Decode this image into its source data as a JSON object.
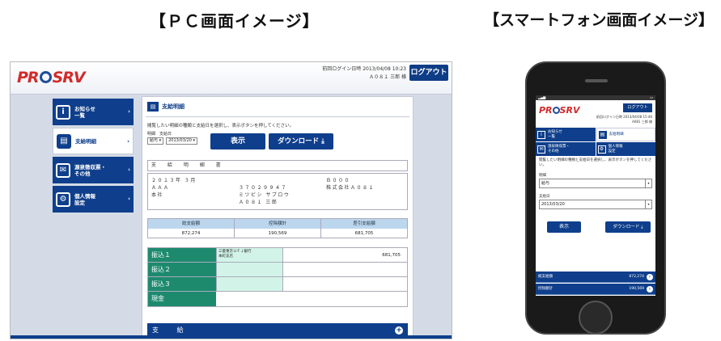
{
  "captions": {
    "pc": "【ＰＣ画面イメージ】",
    "sp": "【スマートフォン画面イメージ】"
  },
  "pc": {
    "logo": {
      "pre": "PR",
      "post": "SRV"
    },
    "login_label": "前回ログイン日時 2013/04/08 10:23",
    "user_name": "Ａ０８１ 三郎 様",
    "logout_label": "ログアウト",
    "menu": [
      {
        "label": "お知らせ\n一覧",
        "icon": "info-icon"
      },
      {
        "label": "支給明細",
        "icon": "statement-icon"
      },
      {
        "label": "源泉徴収票・\nその他",
        "icon": "withholding-icon"
      },
      {
        "label": "個人情報\n設定",
        "icon": "settings-icon"
      }
    ],
    "section_title": "支給明細",
    "instruction": "閲覧したい明細の種類と支給日を選択し、表示ボタンを押してください。",
    "select_labels": "明細　支給日",
    "select_kind": "給与",
    "select_date": "2013/03/20",
    "show_button": "表示",
    "download_button": "ダウンロード",
    "slip_heading": "支 給 明 細 書",
    "slip": {
      "period": "２０１３年 ３月",
      "dept_code": "ＡＡＡ",
      "dept": "本社",
      "emp_code": "３７０２９９４７",
      "kana": "ミツビシ サブロウ",
      "name": "Ａ０８１ 三郎",
      "company_code": "Ｂ０００",
      "company": "株式会社Ａ０８１"
    },
    "totals": {
      "headers": [
        "総支給額",
        "控除額計",
        "差引支給額"
      ],
      "values": [
        "872,274",
        "190,569",
        "681,705"
      ]
    },
    "bank_rows": [
      {
        "label": "振込１",
        "bank": "三菱東京ＵＦＪ銀行\n本町支店",
        "amount": "681,705"
      },
      {
        "label": "振込２",
        "bank": "",
        "amount": ""
      },
      {
        "label": "振込３",
        "bank": "",
        "amount": ""
      },
      {
        "label": "現金",
        "bank": "",
        "amount": ""
      }
    ],
    "shikyu_label": "支 給"
  },
  "sp": {
    "logo": {
      "pre": "PR",
      "post": "SRV"
    },
    "logout_label": "ログアウト",
    "login_label": "前回ログイン日時 2013/04/08 15:46",
    "user_name": "A081 三郎 様",
    "menu": [
      {
        "label": "お知らせ\n一覧",
        "icon": "info-icon"
      },
      {
        "label": "支給明細",
        "icon": "statement-icon"
      },
      {
        "label": "源泉徴収票・\nその他",
        "icon": "withholding-icon"
      },
      {
        "label": "個人情報\n設定",
        "icon": "settings-icon"
      }
    ],
    "instruction": "閲覧したい明細の種類と支給日を選択し、表示ボタンを押してください。",
    "kind_label": "明細",
    "kind_value": "給与",
    "date_label": "支給日",
    "date_value": "2013/03/20",
    "show_button": "表示",
    "download_button": "ダウンロード",
    "rows": [
      {
        "label": "総支給額",
        "value": "872,274"
      },
      {
        "label": "控除額計",
        "value": "190,569"
      }
    ]
  },
  "colors": {
    "brand_navy": "#0f3f8c",
    "brand_red": "#d22b2b",
    "bank_green": "#1d8a6e"
  }
}
